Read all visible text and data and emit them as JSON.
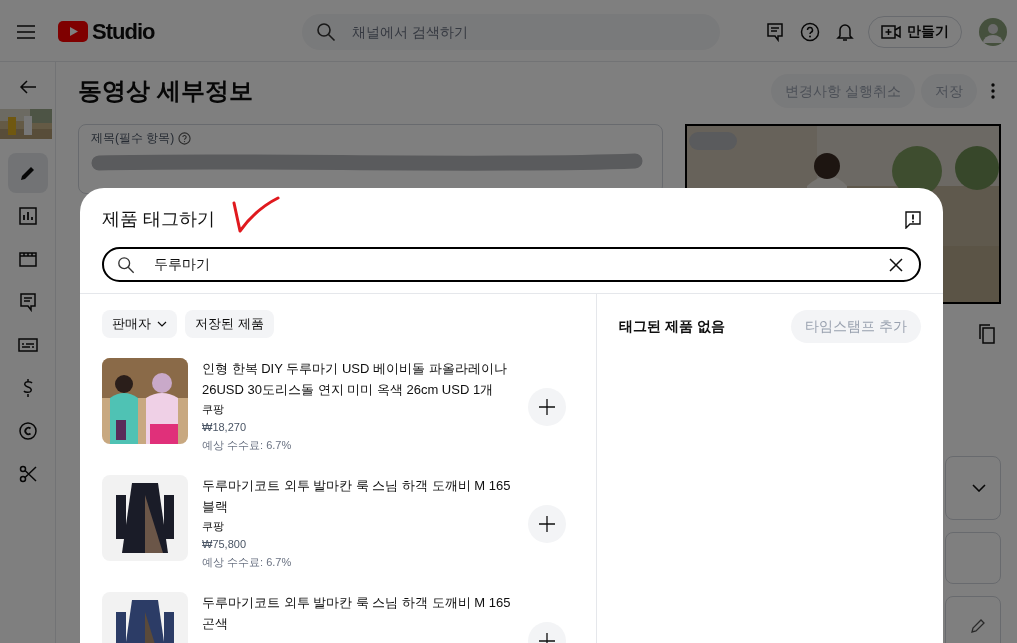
{
  "header": {
    "logo_text": "Studio",
    "search_placeholder": "채널에서 검색하기",
    "create_label": "만들기"
  },
  "page": {
    "title": "동영상 세부정보",
    "undo_label": "변경사항 실행취소",
    "save_label": "저장",
    "title_field_label": "제목(필수 항목)"
  },
  "rail": [
    {
      "kind": "pencil",
      "selected": true
    },
    {
      "kind": "chart",
      "selected": false
    },
    {
      "kind": "film",
      "selected": false
    },
    {
      "kind": "comment",
      "selected": false
    },
    {
      "kind": "subtitles",
      "selected": false
    },
    {
      "kind": "dollar",
      "selected": false
    },
    {
      "kind": "copyright",
      "selected": false
    },
    {
      "kind": "scissors",
      "selected": false
    }
  ],
  "dialog": {
    "title": "제품 태그하기",
    "search_value": "두루마기",
    "filters": [
      {
        "label": "판매자",
        "dropdown": true
      },
      {
        "label": "저장된 제품",
        "dropdown": false
      }
    ],
    "products": [
      {
        "title": "인형 한복 DIY 두루마기 USD 베이비돌 파올라레이나 26USD 30도리스돌 연지 미미 옥색 26cm USD 1개",
        "seller": "쿠팡",
        "price": "₩18,270",
        "fee": "예상 수수료: 6.7%"
      },
      {
        "title": "두루마기코트 외투 발마칸 룩 스님 하객 도깨비 M 165 블랙",
        "seller": "쿠팡",
        "price": "₩75,800",
        "fee": "예상 수수료: 6.7%"
      },
      {
        "title": "두루마기코트 외투 발마칸 룩 스님 하객 도깨비 M 165 곤색"
      }
    ],
    "tagged_empty": "태그된 제품 없음",
    "add_timestamp": {
      "label": "타임스탬프 추가",
      "disabled": true
    }
  }
}
